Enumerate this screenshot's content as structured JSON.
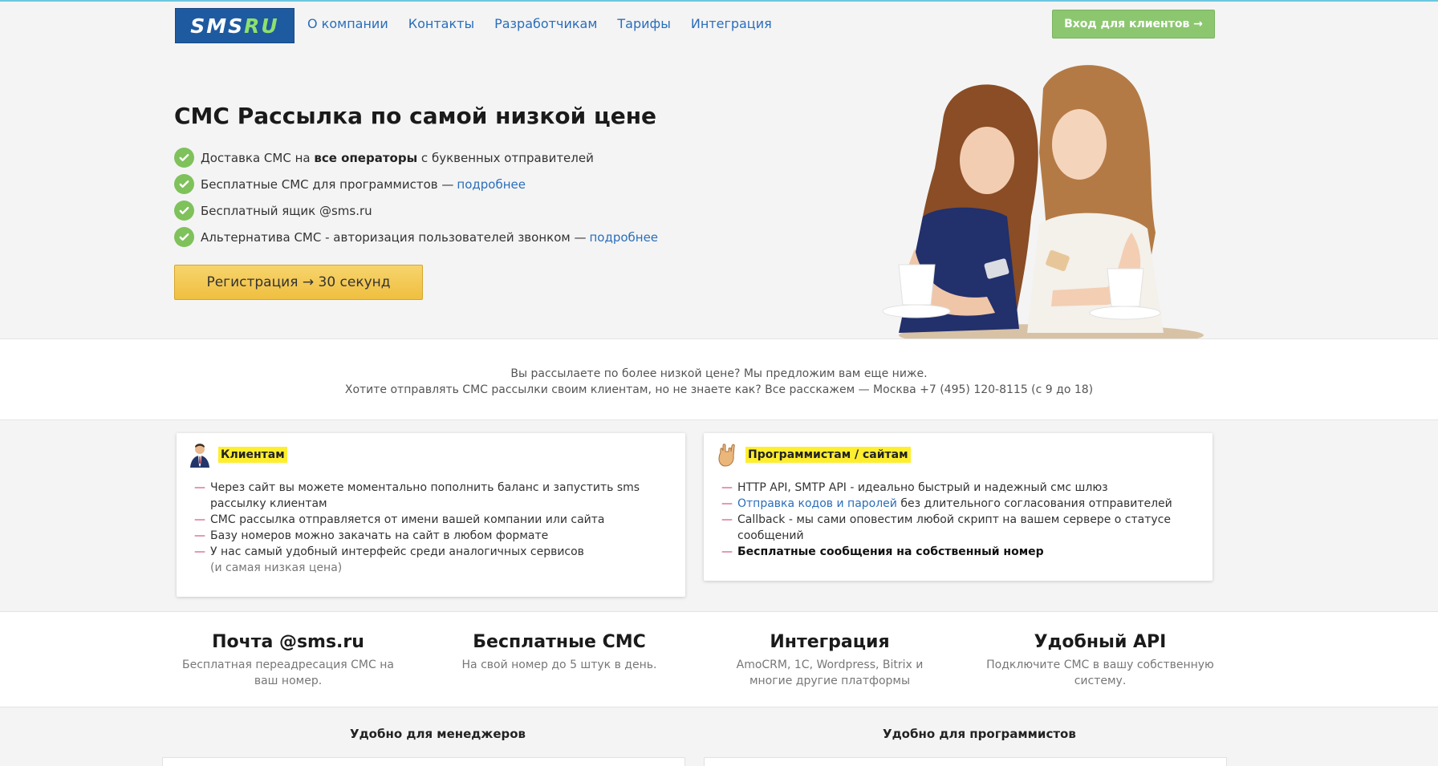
{
  "header": {
    "logo": {
      "main": "SMS",
      "accent": "RU"
    },
    "nav": [
      "О компании",
      "Контакты",
      "Разработчикам",
      "Тарифы",
      "Интеграция"
    ],
    "login_label": "Вход для клиентов →"
  },
  "hero": {
    "title": "СМС Рассылка по самой низкой цене",
    "features": [
      {
        "before": "Доставка СМС на ",
        "bold": "все операторы",
        "after": " с буквенных отправителей"
      },
      {
        "text": "Бесплатные СМС для программистов —",
        "link": "подробнее"
      },
      {
        "text": "Бесплатный ящик @sms.ru"
      },
      {
        "text": "Альтернатива СМС - авторизация пользователей звонком —",
        "link": "подробнее"
      }
    ],
    "register_label": "Регистрация → 30 секунд"
  },
  "info": {
    "line1": "Вы рассылаете по более низкой цене? Мы предложим вам еще ниже.",
    "line2": "Хотите отправлять СМС рассылки своим клиентам, но не знаете как? Все расскажем — Москва  +7 (495) 120-8115 (с 9 до 18)"
  },
  "cards": {
    "clients": {
      "title": "Клиентам",
      "items": [
        "Через сайт вы можете моментально пополнить баланс и запустить sms рассылку клиентам",
        "СМС рассылка отправляется от имени вашей компании или сайта",
        "Базу номеров можно закачать на сайт в любом формате",
        "У нас самый удобный интерфейс среди аналогичных сервисов"
      ],
      "note": "(и самая низкая цена)"
    },
    "programmers": {
      "title": "Программистам / сайтам",
      "item1": "HTTP API, SMTP API - идеально быстрый и надежный смс шлюз",
      "item2_link": "Отправка кодов и паролей",
      "item2_rest": " без длительного согласования отправителей",
      "item3": "Callback - мы сами оповестим любой скрипт на вашем сервере о статусе сообщений",
      "item4": "Бесплатные сообщения на собственный номер"
    }
  },
  "features_row": [
    {
      "title": "Почта @sms.ru",
      "desc": "Бесплатная переадресация СМС на ваш номер."
    },
    {
      "title": "Бесплатные СМС",
      "desc": "На свой номер до 5 штук в день."
    },
    {
      "title": "Интеграция",
      "desc": "AmoCRM, 1C, Wordpress, Bitrix и многие другие платформы"
    },
    {
      "title": "Удобный API",
      "desc": "Подключите СМС в вашу собственную систему."
    }
  ],
  "bottom": {
    "managers": "Удобно для менеджеров",
    "programmers": "Удобно для программистов"
  },
  "colors": {
    "link": "#2a6ebb",
    "login_button": "#8cc770",
    "register_button": "#efbf3f",
    "check": "#7fc15b",
    "highlight": "#ffee2e",
    "logo_bg": "#1e5aa0"
  },
  "icons": [
    "check-icon",
    "businessman-icon",
    "rock-hand-icon"
  ]
}
